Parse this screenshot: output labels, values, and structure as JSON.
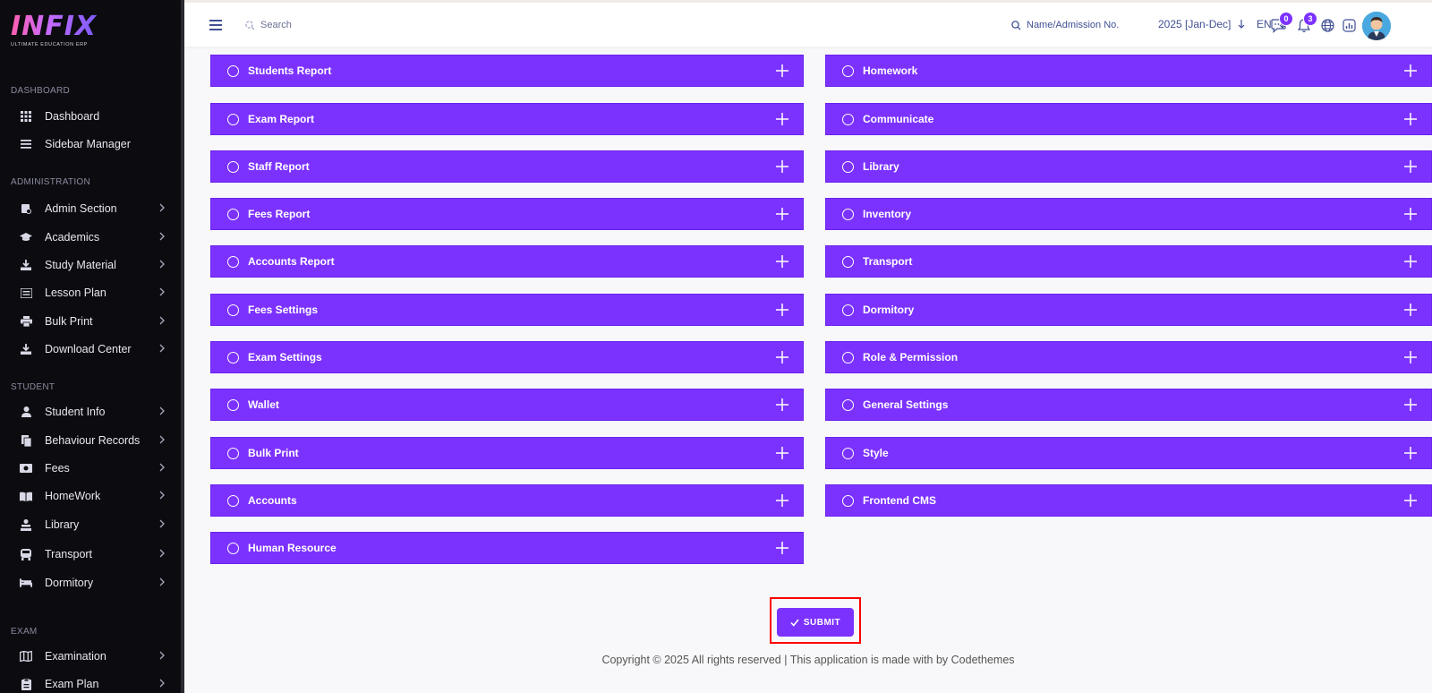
{
  "brand": {
    "logo_text": "INFIX",
    "tagline": "ULTIMATE EDUCATION ERP"
  },
  "sidebar": {
    "sections": [
      {
        "title": "DASHBOARD",
        "items": [
          {
            "label": "Dashboard",
            "icon": "grid-icon",
            "chevron": false
          },
          {
            "label": "Sidebar Manager",
            "icon": "bars-icon",
            "chevron": false
          }
        ]
      },
      {
        "title": "ADMINISTRATION",
        "items": [
          {
            "label": "Admin Section",
            "icon": "admin-icon",
            "chevron": true
          },
          {
            "label": "Academics",
            "icon": "graduation-cap-icon",
            "chevron": true
          },
          {
            "label": "Study Material",
            "icon": "download-icon",
            "chevron": true
          },
          {
            "label": "Lesson Plan",
            "icon": "list-icon",
            "chevron": true
          },
          {
            "label": "Bulk Print",
            "icon": "printer-icon",
            "chevron": true
          },
          {
            "label": "Download Center",
            "icon": "download-icon",
            "chevron": true
          }
        ]
      },
      {
        "title": "STUDENT",
        "items": [
          {
            "label": "Student Info",
            "icon": "user-icon",
            "chevron": true
          },
          {
            "label": "Behaviour Records",
            "icon": "file-icon",
            "chevron": true
          },
          {
            "label": "Fees",
            "icon": "money-icon",
            "chevron": true
          },
          {
            "label": "HomeWork",
            "icon": "book-icon",
            "chevron": true
          },
          {
            "label": "Library",
            "icon": "library-icon",
            "chevron": true
          },
          {
            "label": "Transport",
            "icon": "bus-icon",
            "chevron": true
          },
          {
            "label": "Dormitory",
            "icon": "bed-icon",
            "chevron": true
          }
        ]
      },
      {
        "title": "EXAM",
        "items": [
          {
            "label": "Examination",
            "icon": "map-icon",
            "chevron": true
          },
          {
            "label": "Exam Plan",
            "icon": "clipboard-icon",
            "chevron": true
          }
        ]
      }
    ]
  },
  "header": {
    "search_placeholder": "Search",
    "admission_placeholder": "Name/Admission No.",
    "year": "2025 [Jan-Dec]",
    "language": "EN",
    "messages_count": "0",
    "notifications_count": "3"
  },
  "modules": {
    "left": [
      "Students Report",
      "Exam Report",
      "Staff Report",
      "Fees Report",
      "Accounts Report",
      "Fees Settings",
      "Exam Settings",
      "Wallet",
      "Bulk Print",
      "Accounts",
      "Human Resource"
    ],
    "right": [
      "Homework",
      "Communicate",
      "Library",
      "Inventory",
      "Transport",
      "Dormitory",
      "Role & Permission",
      "General Settings",
      "Style",
      "Frontend CMS"
    ]
  },
  "actions": {
    "submit_label": "SUBMIT"
  },
  "footer": {
    "text": "Copyright © 2025 All rights reserved | This application is made with by Codethemes"
  },
  "colors": {
    "accent": "#7c32ff",
    "sidebar_bg": "#0c0c10",
    "highlight": "#ff0000"
  }
}
